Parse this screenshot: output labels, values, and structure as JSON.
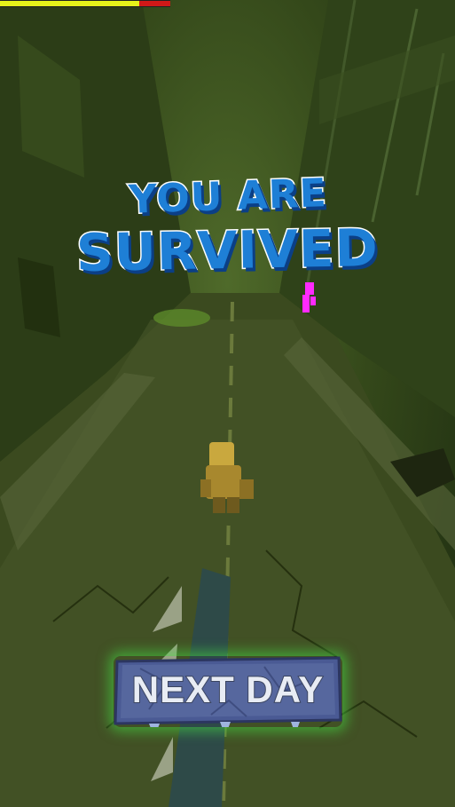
{
  "game": {
    "title_line1": "YOU ARE",
    "title_line2": "SURVIVED",
    "next_button_label": "NEXT DAY",
    "player_health_fraction": 0.82
  },
  "colors": {
    "title_fill": "#1e7fd6",
    "title_shadow": "#0b3f86",
    "health_good": "#e6f21a",
    "health_lost": "#d01818",
    "button_glow": "#46e646",
    "enemy_marker": "#ff2aff"
  },
  "icons": {
    "player": "hazmat-survivor-icon",
    "enemy": "zombie-marker-icon"
  }
}
